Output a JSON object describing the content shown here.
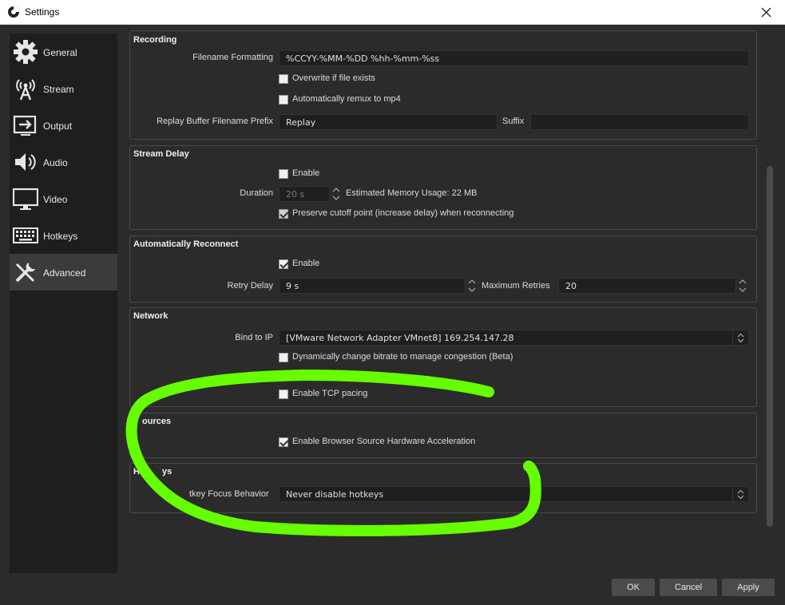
{
  "window": {
    "title": "Settings"
  },
  "sidebar": {
    "items": [
      {
        "label": "General",
        "icon": "gear-icon"
      },
      {
        "label": "Stream",
        "icon": "antenna-icon"
      },
      {
        "label": "Output",
        "icon": "output-icon"
      },
      {
        "label": "Audio",
        "icon": "speaker-icon"
      },
      {
        "label": "Video",
        "icon": "monitor-icon"
      },
      {
        "label": "Hotkeys",
        "icon": "keyboard-icon"
      },
      {
        "label": "Advanced",
        "icon": "tools-icon",
        "active": true
      }
    ]
  },
  "recording": {
    "title": "Recording",
    "filename_label": "Filename Formatting",
    "filename_value": "%CCYY-%MM-%DD %hh-%mm-%ss",
    "overwrite_label": "Overwrite if file exists",
    "overwrite_checked": false,
    "remux_label": "Automatically remux to mp4",
    "remux_checked": false,
    "replay_prefix_label": "Replay Buffer Filename Prefix",
    "replay_prefix_value": "Replay",
    "suffix_label": "Suffix",
    "suffix_value": ""
  },
  "stream_delay": {
    "title": "Stream Delay",
    "enable_label": "Enable",
    "enable_checked": false,
    "duration_label": "Duration",
    "duration_value": "20 s",
    "memory_text": "Estimated Memory Usage: 22 MB",
    "preserve_label": "Preserve cutoff point (increase delay) when reconnecting",
    "preserve_checked": true
  },
  "reconnect": {
    "title": "Automatically Reconnect",
    "enable_label": "Enable",
    "enable_checked": true,
    "retry_delay_label": "Retry Delay",
    "retry_delay_value": "9 s",
    "max_retries_label": "Maximum Retries",
    "max_retries_value": "20"
  },
  "network": {
    "title": "Network",
    "bind_label": "Bind to IP",
    "bind_value": "[VMware Network Adapter VMnet8] 169.254.147.28",
    "dynamic_label": "Dynamically change bitrate to manage congestion (Beta)",
    "dynamic_checked": false,
    "tcp_label": "Enable TCP pacing",
    "tcp_checked": false
  },
  "sources": {
    "title": "ources",
    "browser_accel_label": "Enable Browser Source Hardware Acceleration",
    "browser_accel_checked": true
  },
  "hotkeys": {
    "title": "Ho",
    "title_tail": "ys",
    "focus_label": "tkey Focus Behavior",
    "focus_value": "Never disable hotkeys"
  },
  "buttons": {
    "ok": "OK",
    "cancel": "Cancel",
    "apply": "Apply"
  },
  "colors": {
    "annotation": "#66ff00",
    "background": "#2b2b2b",
    "sidebar": "#1e1e1e"
  }
}
